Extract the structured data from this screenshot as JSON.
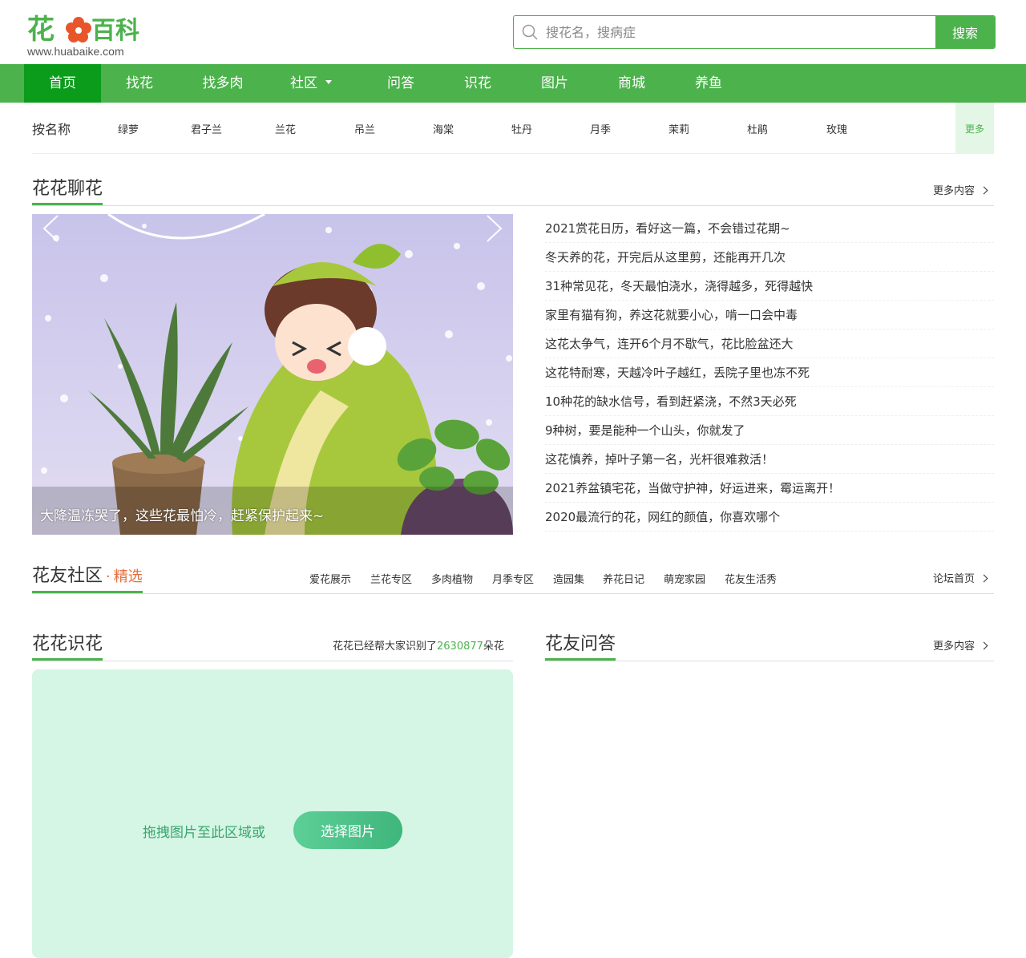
{
  "logo": {
    "name": "花百科",
    "url": "www.huabaike.com"
  },
  "search": {
    "placeholder": "搜花名，搜病症",
    "button": "搜索"
  },
  "nav": [
    "首页",
    "找花",
    "找多肉",
    "社区",
    "问答",
    "识花",
    "图片",
    "商城",
    "养鱼"
  ],
  "names": {
    "label": "按名称",
    "items": [
      "绿萝",
      "君子兰",
      "兰花",
      "吊兰",
      "海棠",
      "牡丹",
      "月季",
      "茉莉",
      "杜鹃",
      "玫瑰"
    ],
    "more": "更多"
  },
  "chat": {
    "title": "花花聊花",
    "more": "更多内容",
    "banner_caption": "大降温冻哭了，这些花最怕冷，赶紧保护起来~",
    "articles": [
      "2021赏花日历，看好这一篇，不会错过花期~",
      "冬天养的花，开完后从这里剪，还能再开几次",
      "31种常见花，冬天最怕浇水，浇得越多，死得越快",
      "家里有猫有狗，养这花就要小心，啃一口会中毒",
      "这花太争气，连开6个月不歇气，花比脸盆还大",
      "这花特耐寒，天越冷叶子越红，丢院子里也冻不死",
      "10种花的缺水信号，看到赶紧浇，不然3天必死",
      "9种树，要是能种一个山头，你就发了",
      "这花慎养，掉叶子第一名，光杆很难救活！",
      "2021养盆镇宅花，当做守护神，好运进来，霉运离开！",
      "2020最流行的花，网红的颜值，你喜欢哪个"
    ]
  },
  "community": {
    "title": "花友社区",
    "dot": "·",
    "subtitle": "精选",
    "tags": [
      "爱花展示",
      "兰花专区",
      "多肉植物",
      "月季专区",
      "造园集",
      "养花日记",
      "萌宠家园",
      "花友生活秀"
    ],
    "home": "论坛首页"
  },
  "identify": {
    "title": "花花识花",
    "count_prefix": "花花已经帮大家识别了",
    "count": "2630877",
    "count_suffix": "朵花",
    "drop_text": "拖拽图片至此区域或",
    "select_button": "选择图片"
  },
  "qa": {
    "title": "花友问答",
    "more": "更多内容"
  },
  "colors": {
    "brand": "#4cb24c",
    "nav_active": "#0a9c1a",
    "accent": "#e86d3c",
    "upload_bg": "#d5f5e5"
  }
}
